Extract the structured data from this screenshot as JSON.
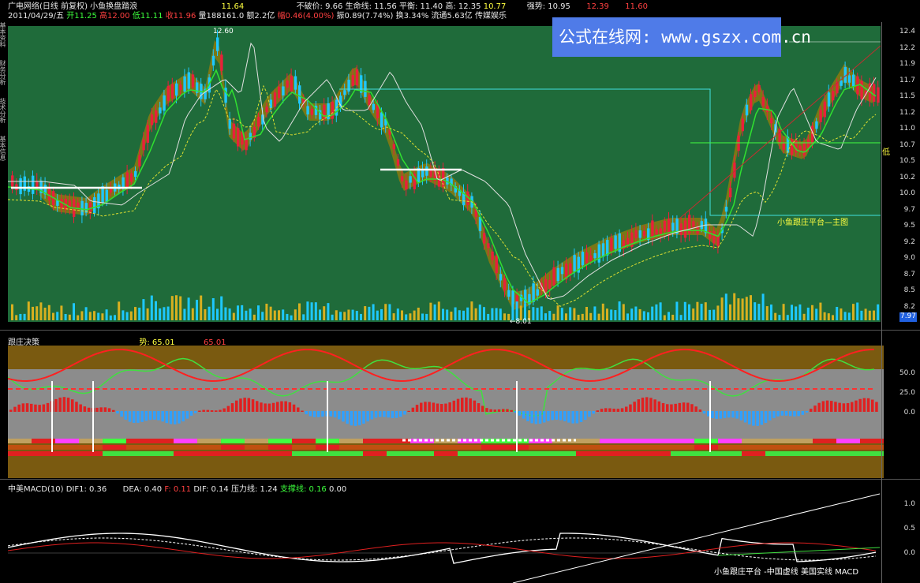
{
  "header": {
    "row1": {
      "title": "广电网络(日线 前复权) 小鱼换盘踏浪",
      "v1": "11.64",
      "market_cost_label": "不破价: 9.66",
      "life_label": "生命线: 11.56",
      "balance_label": "平衡: 11.40",
      "high_label": "高: 12.35",
      "v2": "10.77",
      "strong_label": "强势: 10.95",
      "v3": "12.39",
      "v4": "11.60"
    },
    "row2": {
      "date": "2011/04/29/五",
      "open": "开11.25",
      "high": "高12.00",
      "low": "低11.11",
      "close": "收11.96",
      "vol": "量188161.0",
      "amt": "额2.2亿",
      "chg": "幅0.46(4.00%)",
      "amp": "振0.89(7.74%)",
      "turn": "换3.34%",
      "float": "流通5.63亿",
      "sector": "传媒娱乐"
    }
  },
  "watermark": "公式在线网: www.gszx.com.cn",
  "left_tabs": [
    "基本资料",
    "财务分析",
    "技术分析",
    "基本信息"
  ],
  "main_chart": {
    "y_ticks": [
      "12.4",
      "12.2",
      "11.9",
      "11.7",
      "11.5",
      "11.2",
      "11.0",
      "10.7",
      "10.5",
      "10.2",
      "10.0",
      "9.7",
      "9.5",
      "9.2",
      "9.0",
      "8.7",
      "8.5",
      "8.2"
    ],
    "peak_label": "12.60",
    "low_label": "←8.01",
    "price_tag": "7.97",
    "platform_label": "小鱼跟庄平台—主图",
    "low_tag": "低"
  },
  "panel2": {
    "title": "跟庄决策",
    "trend_label": "势: 65.01",
    "trend_value": "65.01",
    "y_ticks": [
      "50.0",
      "25.0",
      "0.0"
    ]
  },
  "panel3": {
    "title": "中美MACD(10)",
    "dif1": "DIF1: 0.36",
    "dea": "DEA: 0.40",
    "f": "F: 0.11",
    "dif": "DIF: 0.14",
    "pressure": "压力线: 1.24",
    "support": "支撑线: 0.16",
    "extra": "0.00",
    "y_ticks": [
      "1.0",
      "0.5",
      "0.0"
    ],
    "caption": "小鱼跟庄平台 -中国虚线 美国实线 MACD"
  },
  "colors": {
    "main_bg": "#1f6b3a",
    "up": "#e8203a",
    "down": "#1ec8ff",
    "band": "#8a7a10",
    "panel2_band": "#7a5a10",
    "panel2_gray": "#8c8c8c"
  }
}
